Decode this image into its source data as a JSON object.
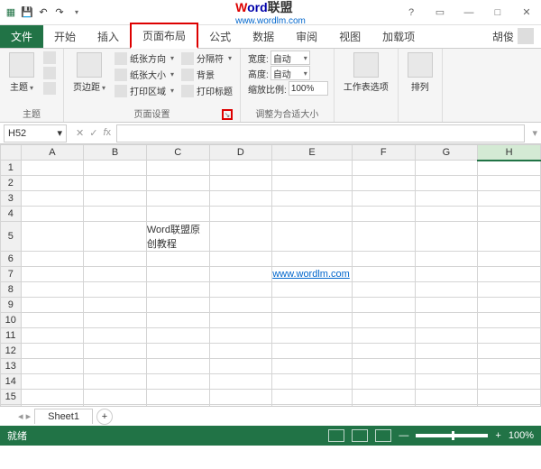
{
  "titlebar": {
    "brand_w": "W",
    "brand_ord": "ord",
    "brand_cn": "联盟",
    "brand_url": "www.wordlm.com"
  },
  "tabs": {
    "file": "文件",
    "home": "开始",
    "insert": "插入",
    "pagelayout": "页面布局",
    "formulas": "公式",
    "data": "数据",
    "review": "审阅",
    "view": "视图",
    "addins": "加载项",
    "username": "胡俊"
  },
  "ribbon": {
    "themes": {
      "label": "主题",
      "btn_theme": "主题"
    },
    "pagesetup": {
      "label": "页面设置",
      "margins": "页边距",
      "orientation": "纸张方向",
      "size": "纸张大小",
      "printarea": "打印区域",
      "breaks": "分隔符",
      "background": "背景",
      "printtitles": "打印标题"
    },
    "scale": {
      "label": "调整为合适大小",
      "width_lbl": "宽度:",
      "height_lbl": "高度:",
      "scale_lbl": "缩放比例:",
      "width_val": "自动",
      "height_val": "自动",
      "scale_val": "100%"
    },
    "sheetopt": {
      "label": "工作表选项"
    },
    "arrange": {
      "label": "排列"
    }
  },
  "namebox": {
    "value": "H52"
  },
  "columns": [
    "A",
    "B",
    "C",
    "D",
    "E",
    "F",
    "G",
    "H"
  ],
  "rows_count": 16,
  "cells": {
    "C5": "Word联盟原创教程",
    "E7": "www.wordlm.com"
  },
  "sheets": {
    "sheet1": "Sheet1"
  },
  "statusbar": {
    "ready": "就绪",
    "zoom": "100%"
  }
}
